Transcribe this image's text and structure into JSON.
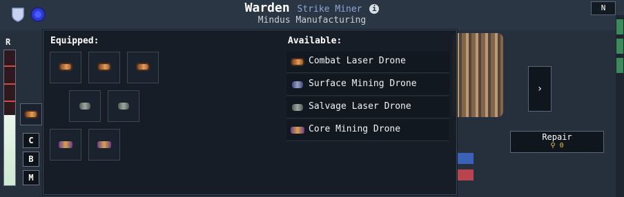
{
  "header": {
    "ship_name": "Warden",
    "ship_class": "Strike Miner",
    "info_glyph": "i",
    "manufacturer": "Mindus Manufacturing",
    "n_button": "N"
  },
  "left_panel": {
    "r_label": "R",
    "r_level": 0.52,
    "buttons": [
      "C",
      "B",
      "M"
    ]
  },
  "right_panel": {
    "next_glyph": "›",
    "repair_label": "Repair",
    "repair_cost": "⚲ 0"
  },
  "drone_popup": {
    "equipped_label": "Equipped:",
    "available_label": "Available:",
    "equipped_icons": [
      "combat-laser-drone-icon",
      "combat-laser-drone-icon",
      "combat-laser-drone-icon",
      "salvage-laser-drone-icon",
      "salvage-laser-drone-icon",
      "core-mining-drone-icon",
      "core-mining-drone-icon"
    ],
    "available": [
      {
        "label": "Combat Laser Drone",
        "icon": "combat-laser-drone-icon"
      },
      {
        "label": "Surface Mining Drone",
        "icon": "surface-mining-drone-icon"
      },
      {
        "label": "Salvage Laser Drone",
        "icon": "salvage-laser-drone-icon"
      },
      {
        "label": "Core Mining Drone",
        "icon": "core-mining-drone-icon"
      }
    ]
  },
  "colors": {
    "background": "#26303d",
    "popup": "#151c26",
    "accent_class": "#8fa6d8",
    "repair_cost": "#e3c14a"
  }
}
